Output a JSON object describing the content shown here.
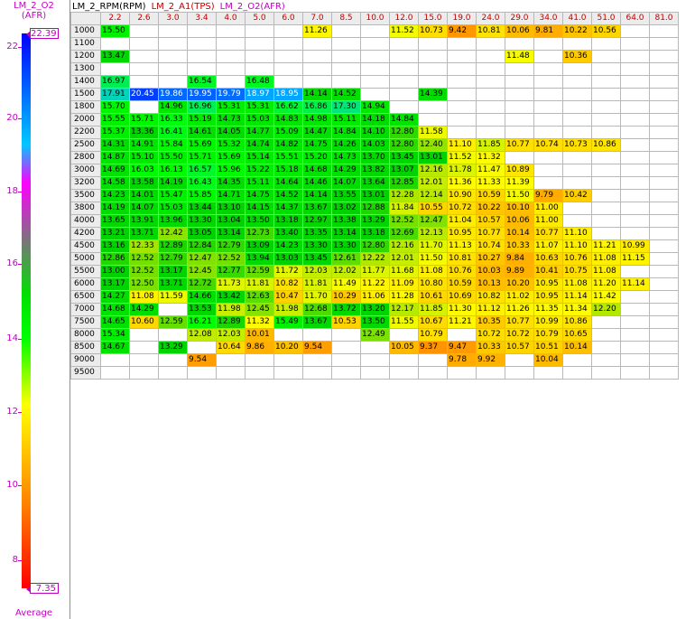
{
  "legend": {
    "title_line1": "LM_2_O2",
    "title_line2": "(AFR)",
    "max_value": "22.39",
    "min_value": "7.35",
    "footer": "Average",
    "ticks": [
      "22",
      "20",
      "18",
      "16",
      "14",
      "12",
      "10",
      "8"
    ]
  },
  "header": {
    "x_axis_label": "LM_2_RPM(RPM)",
    "y_axis_label": "LM_2_A1(TPS)",
    "z_axis_label": "LM_2_O2(AFR)"
  },
  "columns": [
    "2.2",
    "2.6",
    "3.0",
    "3.4",
    "4.0",
    "5.0",
    "6.0",
    "7.0",
    "8.5",
    "10.0",
    "12.0",
    "15.0",
    "19.0",
    "24.0",
    "29.0",
    "34.0",
    "41.0",
    "51.0",
    "64.0",
    "81.0"
  ],
  "rows": [
    {
      "rpm": "1000",
      "cells": [
        "15.50",
        "",
        "",
        "",
        "",
        "",
        "",
        "11.26",
        "",
        "",
        "11.52",
        "10.73",
        "9.42",
        "10.81",
        "10.06",
        "9.81",
        "10.22",
        "10.56",
        "",
        ""
      ]
    },
    {
      "rpm": "1100",
      "cells": [
        "",
        "",
        "",
        "",
        "",
        "",
        "",
        "",
        "",
        "",
        "",
        "",
        "",
        "",
        "",
        "",
        "",
        "",
        "",
        ""
      ]
    },
    {
      "rpm": "1200",
      "cells": [
        "13.47",
        "",
        "",
        "",
        "",
        "",
        "",
        "",
        "",
        "",
        "",
        "",
        "",
        "",
        "11.48",
        "",
        "10.36",
        "",
        "",
        ""
      ]
    },
    {
      "rpm": "1300",
      "cells": [
        "",
        "",
        "",
        "",
        "",
        "",
        "",
        "",
        "",
        "",
        "",
        "",
        "",
        "",
        "",
        "",
        "",
        "",
        "",
        ""
      ]
    },
    {
      "rpm": "1400",
      "cells": [
        "16.97",
        "",
        "",
        "16.54",
        "",
        "16.48",
        "",
        "",
        "",
        "",
        "",
        "",
        "",
        "",
        "",
        "",
        "",
        "",
        "",
        ""
      ]
    },
    {
      "rpm": "1500",
      "cells": [
        "17.91",
        "20.45",
        "19.86",
        "19.95",
        "19.79",
        "18.97",
        "18.95",
        "14.14",
        "14.52",
        "",
        "",
        "14.39",
        "",
        "",
        "",
        "",
        "",
        "",
        "",
        ""
      ]
    },
    {
      "rpm": "1800",
      "cells": [
        "15.70",
        "",
        "14.96",
        "16.96",
        "15.31",
        "15.31",
        "16.62",
        "16.86",
        "17.30",
        "14.94",
        "",
        "",
        "",
        "",
        "",
        "",
        "",
        "",
        "",
        ""
      ]
    },
    {
      "rpm": "2000",
      "cells": [
        "15.55",
        "15.71",
        "16.33",
        "15.19",
        "14.73",
        "15.03",
        "14.83",
        "14.98",
        "15.11",
        "14.18",
        "14.84",
        "",
        "",
        "",
        "",
        "",
        "",
        "",
        "",
        ""
      ]
    },
    {
      "rpm": "2200",
      "cells": [
        "15.37",
        "13.36",
        "16.41",
        "14.61",
        "14.05",
        "14.77",
        "15.09",
        "14.47",
        "14.84",
        "14.10",
        "12.80",
        "11.58",
        "",
        "",
        "",
        "",
        "",
        "",
        "",
        ""
      ]
    },
    {
      "rpm": "2500",
      "cells": [
        "14.31",
        "14.91",
        "15.84",
        "15.69",
        "15.32",
        "14.74",
        "14.82",
        "14.75",
        "14.26",
        "14.03",
        "12.80",
        "12.40",
        "11.10",
        "11.85",
        "10.77",
        "10.74",
        "10.73",
        "10.86",
        "",
        ""
      ]
    },
    {
      "rpm": "2800",
      "cells": [
        "14.87",
        "15.10",
        "15.50",
        "15.71",
        "15.69",
        "15.14",
        "15.51",
        "15.20",
        "14.73",
        "13.70",
        "13.45",
        "13.01",
        "11.52",
        "11.32",
        "",
        "",
        "",
        "",
        "",
        ""
      ]
    },
    {
      "rpm": "3000",
      "cells": [
        "14.69",
        "16.03",
        "16.13",
        "16.57",
        "15.96",
        "15.22",
        "15.18",
        "14.68",
        "14.29",
        "13.82",
        "13.07",
        "12.16",
        "11.78",
        "11.47",
        "10.89",
        "",
        "",
        "",
        "",
        ""
      ]
    },
    {
      "rpm": "3200",
      "cells": [
        "14.58",
        "13.58",
        "14.19",
        "16.43",
        "14.35",
        "15.11",
        "14.64",
        "14.46",
        "14.07",
        "13.64",
        "12.85",
        "12.01",
        "11.36",
        "11.33",
        "11.39",
        "",
        "",
        "",
        "",
        ""
      ]
    },
    {
      "rpm": "3500",
      "cells": [
        "14.23",
        "14.01",
        "15.47",
        "15.85",
        "14.71",
        "14.75",
        "14.52",
        "14.14",
        "13.55",
        "13.01",
        "12.28",
        "12.14",
        "10.90",
        "10.59",
        "11.50",
        "9.79",
        "10.42",
        "",
        "",
        ""
      ]
    },
    {
      "rpm": "3800",
      "cells": [
        "14.19",
        "14.07",
        "15.03",
        "13.44",
        "13.10",
        "14.15",
        "14.37",
        "13.67",
        "13.02",
        "12.88",
        "11.84",
        "10.55",
        "10.72",
        "10.22",
        "10.10",
        "11.00",
        "",
        "",
        "",
        ""
      ]
    },
    {
      "rpm": "4000",
      "cells": [
        "13.65",
        "13.91",
        "13.96",
        "13.30",
        "13.04",
        "13.50",
        "13.18",
        "12.97",
        "13.38",
        "13.29",
        "12.52",
        "12.47",
        "11.04",
        "10.57",
        "10.06",
        "11.00",
        "",
        "",
        "",
        ""
      ]
    },
    {
      "rpm": "4200",
      "cells": [
        "13.21",
        "13.71",
        "12.42",
        "13.05",
        "13.14",
        "12.73",
        "13.40",
        "13.35",
        "13.14",
        "13.18",
        "12.69",
        "12.13",
        "10.95",
        "10.77",
        "10.14",
        "10.77",
        "11.10",
        "",
        "",
        ""
      ]
    },
    {
      "rpm": "4500",
      "cells": [
        "13.16",
        "12.33",
        "12.89",
        "12.84",
        "12.79",
        "13.09",
        "14.23",
        "13.30",
        "13.30",
        "12.80",
        "12.16",
        "11.70",
        "11.13",
        "10.74",
        "10.33",
        "11.07",
        "11.10",
        "11.21",
        "10.99",
        ""
      ]
    },
    {
      "rpm": "5000",
      "cells": [
        "12.86",
        "12.52",
        "12.79",
        "12.47",
        "12.52",
        "13.94",
        "13.03",
        "13.45",
        "12.61",
        "12.22",
        "12.01",
        "11.50",
        "10.81",
        "10.27",
        "9.84",
        "10.63",
        "10.76",
        "11.08",
        "11.15",
        ""
      ]
    },
    {
      "rpm": "5500",
      "cells": [
        "13.00",
        "12.52",
        "13.17",
        "12.45",
        "12.77",
        "12.59",
        "11.72",
        "12.03",
        "12.02",
        "11.77",
        "11.68",
        "11.08",
        "10.76",
        "10.03",
        "9.89",
        "10.41",
        "10.75",
        "11.08",
        "",
        ""
      ]
    },
    {
      "rpm": "6000",
      "cells": [
        "13.17",
        "12.50",
        "13.71",
        "12.72",
        "11.73",
        "11.81",
        "10.82",
        "11.81",
        "11.49",
        "11.22",
        "11.09",
        "10.80",
        "10.59",
        "10.13",
        "10.20",
        "10.95",
        "11.08",
        "11.20",
        "11.14",
        ""
      ]
    },
    {
      "rpm": "6500",
      "cells": [
        "14.27",
        "11.08",
        "11.59",
        "14.66",
        "13.42",
        "12.63",
        "10.47",
        "11.70",
        "10.29",
        "11.06",
        "11.28",
        "10.61",
        "10.69",
        "10.82",
        "11.02",
        "10.95",
        "11.14",
        "11.42",
        "",
        ""
      ]
    },
    {
      "rpm": "7000",
      "cells": [
        "14.68",
        "14.29",
        "",
        "13.53",
        "11.98",
        "12.45",
        "11.98",
        "12.68",
        "13.72",
        "13.20",
        "12.17",
        "11.85",
        "11.30",
        "11.12",
        "11.26",
        "11.35",
        "11.34",
        "12.20",
        "",
        ""
      ]
    },
    {
      "rpm": "7500",
      "cells": [
        "14.65",
        "10.60",
        "12.59",
        "16.21",
        "12.89",
        "11.32",
        "15.49",
        "13.67",
        "10.53",
        "13.50",
        "11.55",
        "10.67",
        "11.21",
        "10.35",
        "10.77",
        "10.99",
        "10.86",
        "",
        "",
        ""
      ]
    },
    {
      "rpm": "8000",
      "cells": [
        "15.34",
        "",
        "",
        "12.08",
        "12.03",
        "10.01",
        "",
        "",
        "",
        "12.49",
        "",
        "10.79",
        "",
        "10.72",
        "10.72",
        "10.79",
        "10.65",
        "",
        "",
        ""
      ]
    },
    {
      "rpm": "8500",
      "cells": [
        "14.67",
        "",
        "13.29",
        "",
        "10.64",
        "9.86",
        "10.20",
        "9.54",
        "",
        "",
        "10.05",
        "9.37",
        "9.47",
        "10.33",
        "10.57",
        "10.51",
        "10.14",
        "",
        "",
        ""
      ]
    },
    {
      "rpm": "9000",
      "cells": [
        "",
        "",
        "",
        "9.54",
        "",
        "",
        "",
        "",
        "",
        "",
        "",
        "",
        "9.78",
        "9.92",
        "",
        "10.04",
        "",
        "",
        "",
        ""
      ]
    },
    {
      "rpm": "9500",
      "cells": [
        "",
        "",
        "",
        "",
        "",
        "",
        "",
        "",
        "",
        "",
        "",
        "",
        "",
        "",
        "",
        "",
        "",
        "",
        "",
        ""
      ]
    }
  ]
}
